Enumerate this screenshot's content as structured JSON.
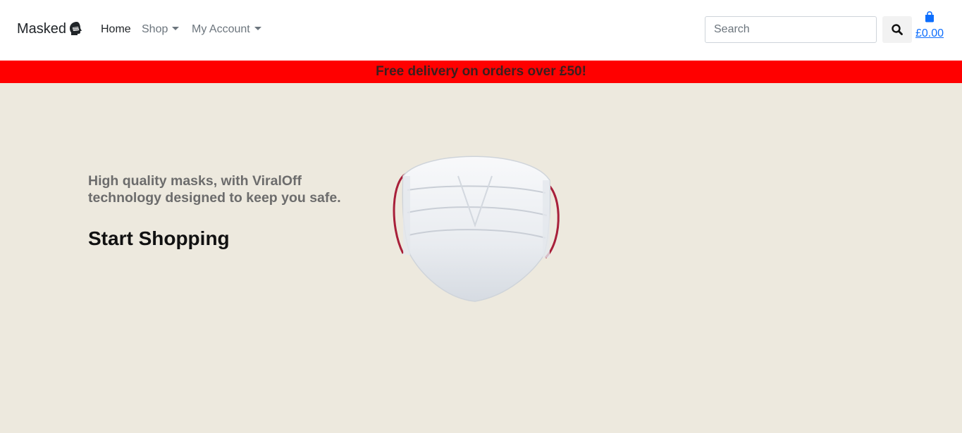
{
  "brand": {
    "name": "Masked",
    "icon": "masked-face-icon"
  },
  "nav": {
    "home": "Home",
    "shop": "Shop",
    "account": "My Account"
  },
  "search": {
    "placeholder": "Search",
    "icon": "search-icon"
  },
  "cart": {
    "total": "£0.00",
    "icon": "shopping-bag-icon"
  },
  "banner": {
    "text": "Free delivery on orders over £50!",
    "color": "#ff0000"
  },
  "hero": {
    "tagline": "High quality masks, with ViralOff technology designed to keep you safe.",
    "cta": "Start Shopping",
    "background": "#ede9de"
  },
  "colors": {
    "link": "#0d6efd",
    "strap": "#a8203a"
  }
}
